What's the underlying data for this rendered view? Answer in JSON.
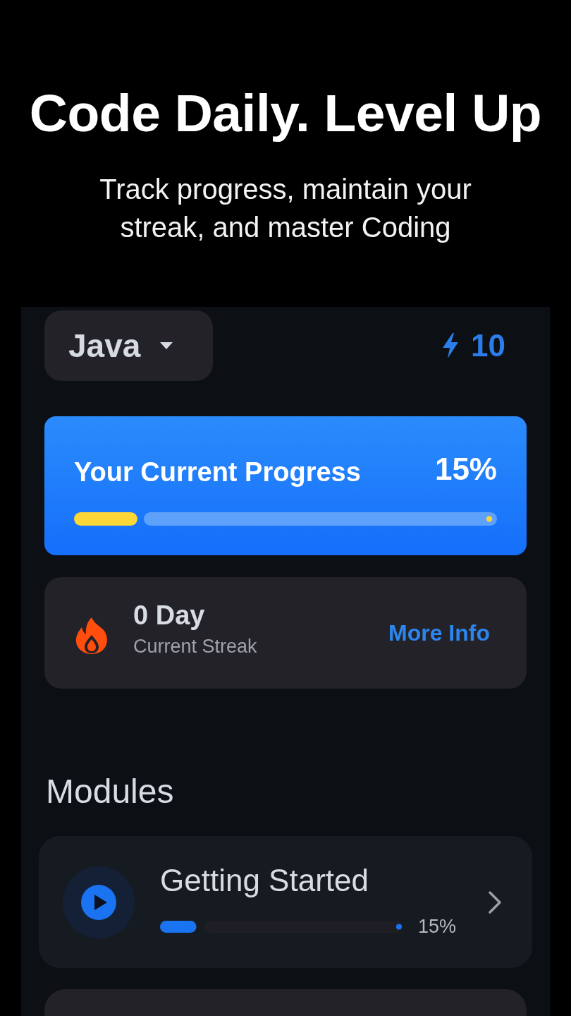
{
  "intro": {
    "title": "Code Daily. Level Up",
    "subtitle": "Track progress, maintain your streak, and master Coding"
  },
  "header": {
    "language": "Java",
    "points": "10"
  },
  "progress_card": {
    "title": "Your Current Progress",
    "percent": "15%",
    "level": 0.15
  },
  "streak_card": {
    "days": "0 Day",
    "label": "Current Streak",
    "link": "More Info"
  },
  "modules": {
    "title": "Modules",
    "items": [
      {
        "title": "Getting Started",
        "level": 0.15,
        "percent": "15%"
      }
    ]
  }
}
